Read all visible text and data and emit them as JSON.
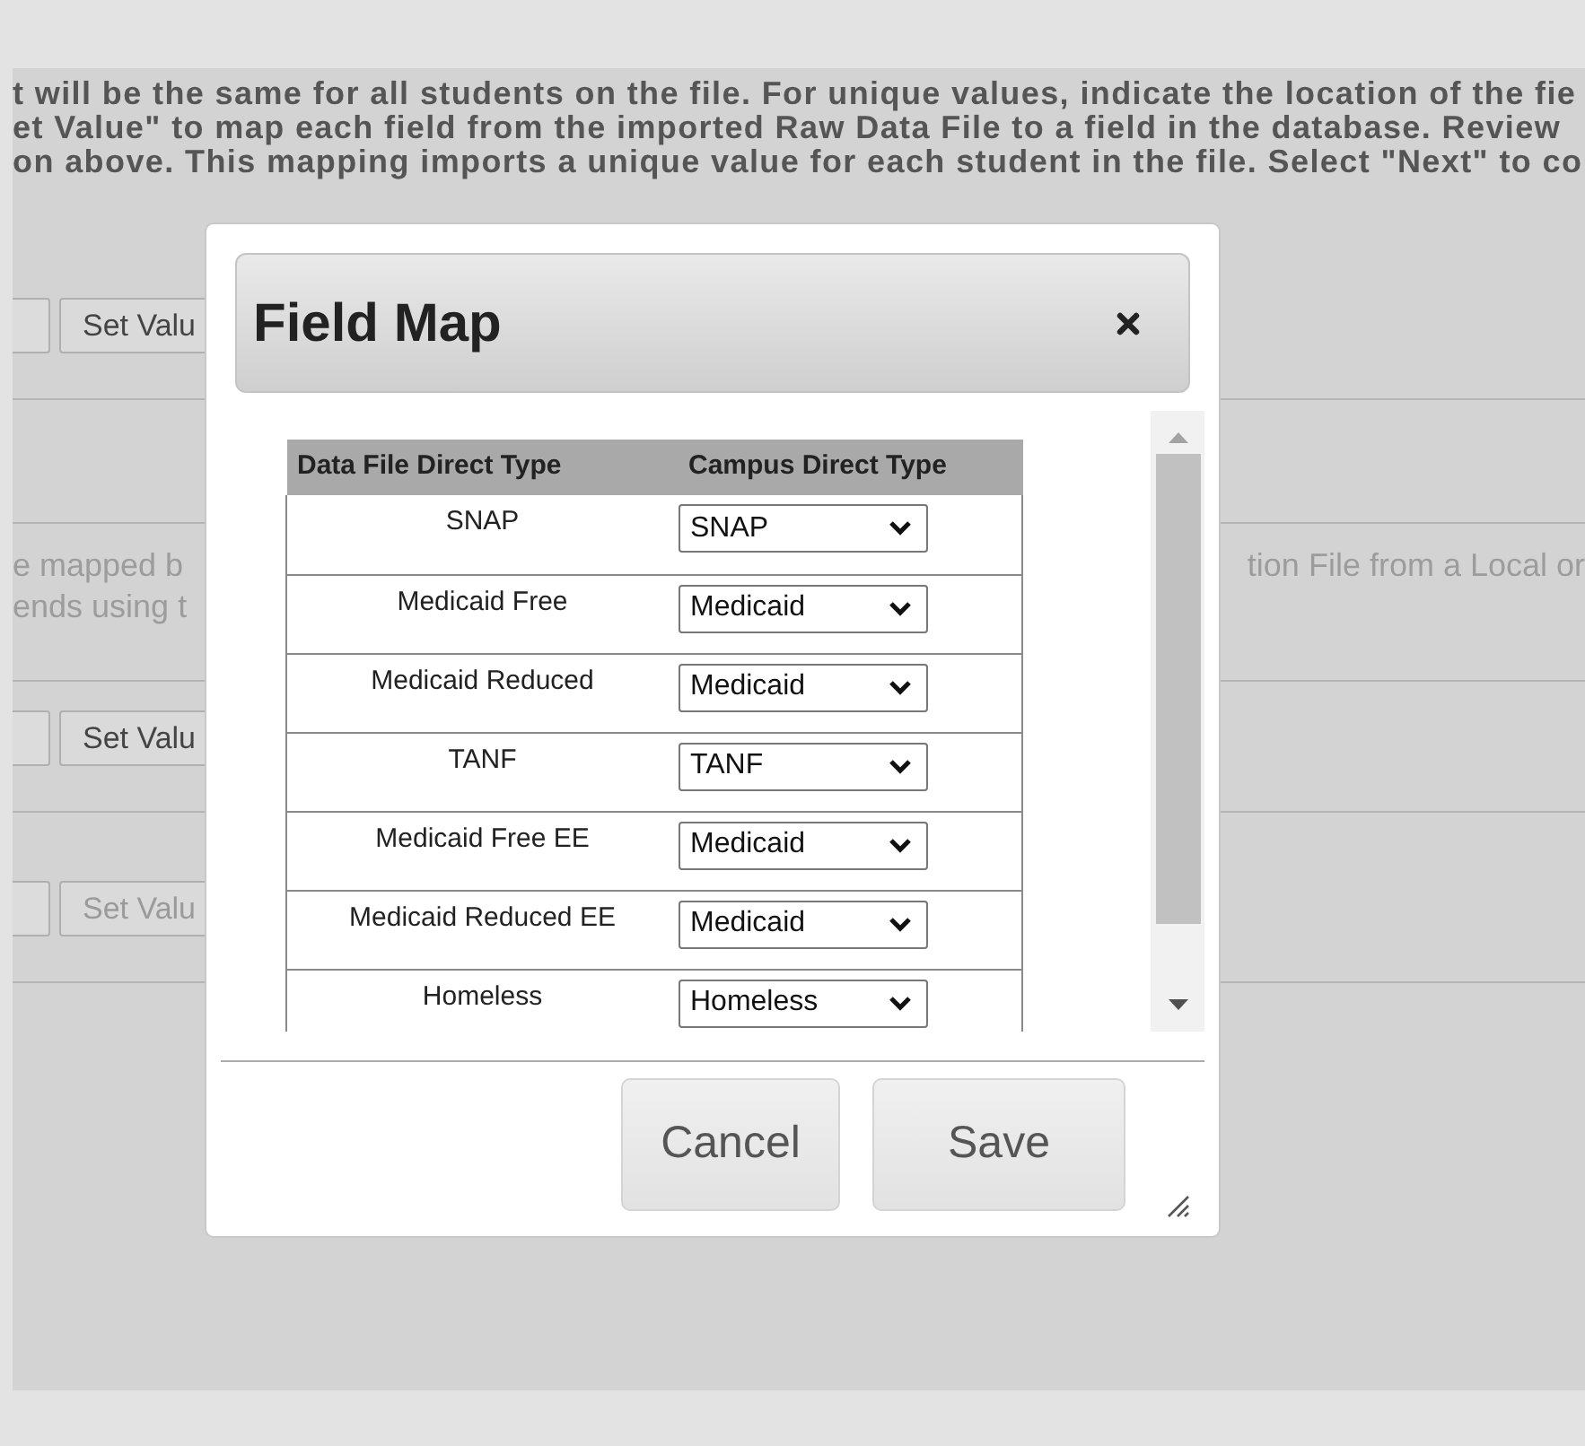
{
  "page": {
    "intro_lines": [
      "t will be the same for all students on the file. For unique values, indicate the location of the fie",
      "et Value\" to map each field from the imported Raw Data File to a field in the database. Review",
      "on above. This mapping imports a unique value for each student in the file. Select \"Next\" to co"
    ],
    "sections": [
      {
        "kind": "set_value",
        "button": "Set Valu",
        "disabled": false
      },
      {
        "kind": "blank"
      },
      {
        "kind": "text",
        "left_lines": [
          "e mapped b",
          "ends using t"
        ],
        "right_line": "tion File from a Local or"
      },
      {
        "kind": "set_value",
        "button": "Set Valu",
        "disabled": false
      },
      {
        "kind": "set_value",
        "button": "Set Valu",
        "disabled": true
      }
    ]
  },
  "dialog": {
    "title": "Field Map",
    "table": {
      "columns": [
        "Data File Direct Type",
        "Campus Direct Type"
      ],
      "rows": [
        {
          "source": "SNAP",
          "target": "SNAP"
        },
        {
          "source": "Medicaid Free",
          "target": "Medicaid"
        },
        {
          "source": "Medicaid Reduced",
          "target": "Medicaid"
        },
        {
          "source": "TANF",
          "target": "TANF"
        },
        {
          "source": "Medicaid Free EE",
          "target": "Medicaid"
        },
        {
          "source": "Medicaid Reduced EE",
          "target": "Medicaid"
        },
        {
          "source": "Homeless",
          "target": "Homeless"
        }
      ]
    },
    "buttons": [
      "Cancel",
      "Save"
    ]
  }
}
